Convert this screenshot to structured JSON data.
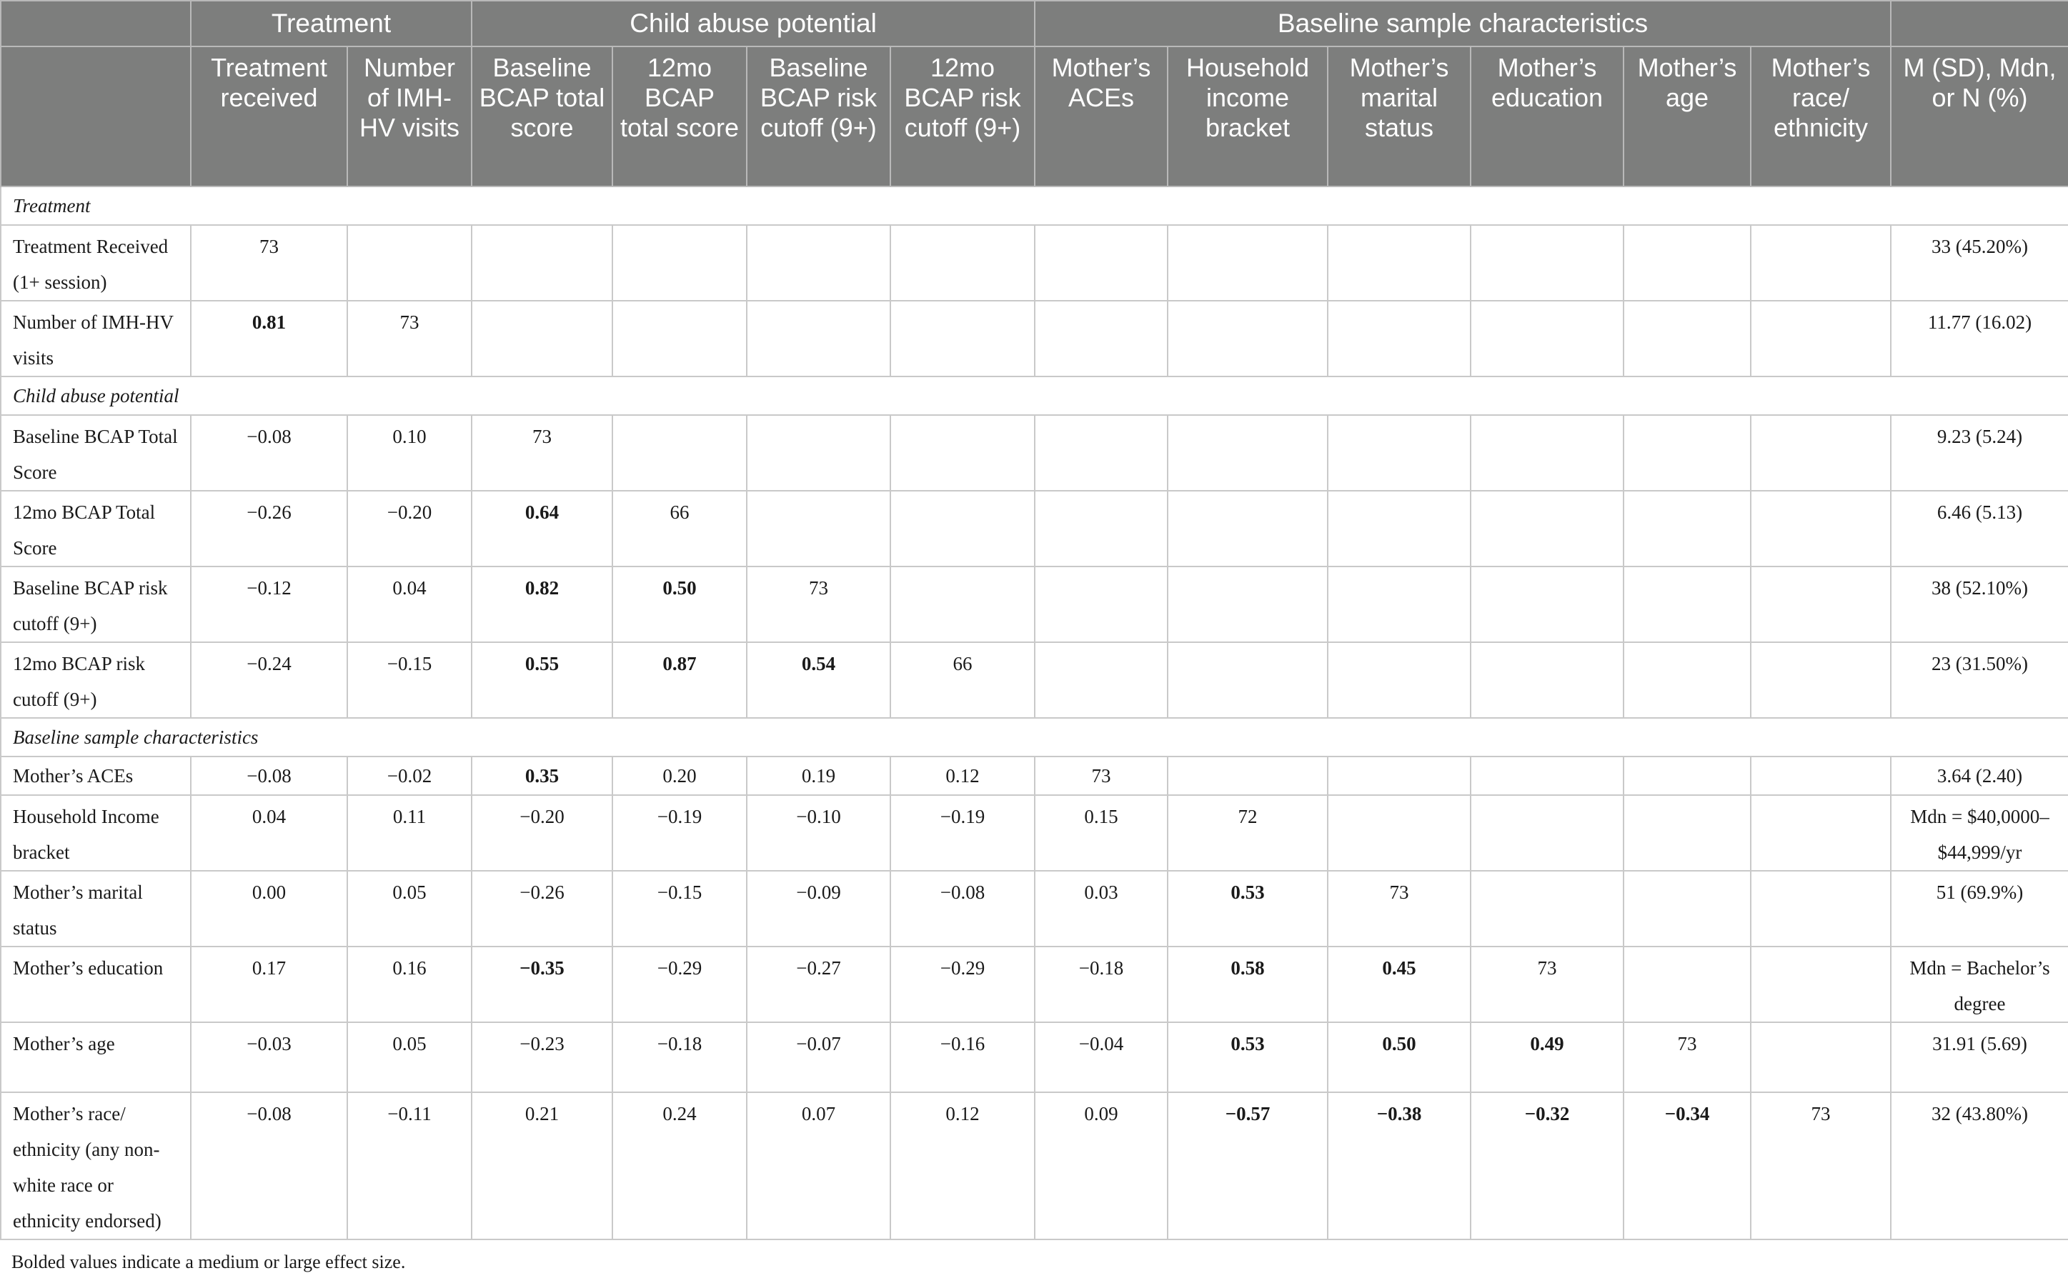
{
  "header": {
    "groups": [
      "Treatment",
      "Child abuse potential",
      "Baseline sample characteristics"
    ],
    "columns": [
      "Treatment received",
      "Number of IMH-HV visits",
      "Baseline BCAP total score",
      "12mo BCAP total score",
      "Baseline BCAP risk cutoff (9+)",
      "12mo BCAP risk cutoff (9+)",
      "Mother’s ACEs",
      "Household income bracket",
      "Mother’s marital status",
      "Mother’s education",
      "Mother’s age",
      "Mother’s race/ ethnicity",
      "M (SD), Mdn, or N (%)"
    ]
  },
  "sections": [
    {
      "title": "Treatment",
      "rows": [
        {
          "label": "Treatment Received (1+ session)",
          "cells": [
            "73",
            "",
            "",
            "",
            "",
            "",
            "",
            "",
            "",
            "",
            "",
            ""
          ],
          "bold": [],
          "summary": "33 (45.20%)"
        },
        {
          "label": "Number of IMH-HV visits",
          "cells": [
            "0.81",
            "73",
            "",
            "",
            "",
            "",
            "",
            "",
            "",
            "",
            "",
            ""
          ],
          "bold": [
            0
          ],
          "summary": "11.77 (16.02)"
        }
      ]
    },
    {
      "title": "Child abuse potential",
      "rows": [
        {
          "label": "Baseline BCAP Total Score",
          "cells": [
            "−0.08",
            "0.10",
            "73",
            "",
            "",
            "",
            "",
            "",
            "",
            "",
            "",
            ""
          ],
          "bold": [],
          "summary": "9.23 (5.24)"
        },
        {
          "label": "12mo BCAP Total Score",
          "cells": [
            "−0.26",
            "−0.20",
            "0.64",
            "66",
            "",
            "",
            "",
            "",
            "",
            "",
            "",
            ""
          ],
          "bold": [
            2
          ],
          "summary": "6.46 (5.13)"
        },
        {
          "label": "Baseline BCAP risk cutoff (9+)",
          "cells": [
            "−0.12",
            "0.04",
            "0.82",
            "0.50",
            "73",
            "",
            "",
            "",
            "",
            "",
            "",
            ""
          ],
          "bold": [
            2,
            3
          ],
          "summary": "38 (52.10%)"
        },
        {
          "label": "12mo BCAP risk cutoff (9+)",
          "cells": [
            "−0.24",
            "−0.15",
            "0.55",
            "0.87",
            "0.54",
            "66",
            "",
            "",
            "",
            "",
            "",
            ""
          ],
          "bold": [
            2,
            3,
            4
          ],
          "summary": "23 (31.50%)"
        }
      ]
    },
    {
      "title": "Baseline sample characteristics",
      "rows": [
        {
          "label": "Mother’s ACEs",
          "cells": [
            "−0.08",
            "−0.02",
            "0.35",
            "0.20",
            "0.19",
            "0.12",
            "73",
            "",
            "",
            "",
            "",
            ""
          ],
          "bold": [
            2
          ],
          "summary": "3.64 (2.40)"
        },
        {
          "label": "Household Income bracket",
          "cells": [
            "0.04",
            "0.11",
            "−0.20",
            "−0.19",
            "−0.10",
            "−0.19",
            "0.15",
            "72",
            "",
            "",
            "",
            ""
          ],
          "bold": [],
          "summary": "Mdn = $40,0000–$44,999/yr"
        },
        {
          "label": "Mother’s marital status",
          "cells": [
            "0.00",
            "0.05",
            "−0.26",
            "−0.15",
            "−0.09",
            "−0.08",
            "0.03",
            "0.53",
            "73",
            "",
            "",
            ""
          ],
          "bold": [
            7
          ],
          "summary": "51 (69.9%)"
        },
        {
          "label": "Mother’s education",
          "cells": [
            "0.17",
            "0.16",
            "−0.35",
            "−0.29",
            "−0.27",
            "−0.29",
            "−0.18",
            "0.58",
            "0.45",
            "73",
            "",
            ""
          ],
          "bold": [
            2,
            7,
            8
          ],
          "summary": "Mdn = Bachelor’s degree"
        },
        {
          "label": "Mother’s age",
          "cells": [
            "−0.03",
            "0.05",
            "−0.23",
            "−0.18",
            "−0.07",
            "−0.16",
            "−0.04",
            "0.53",
            "0.50",
            "0.49",
            "73",
            ""
          ],
          "bold": [
            7,
            8,
            9
          ],
          "summary": "31.91 (5.69)"
        },
        {
          "label": "Mother’s race/ ethnicity (any non-white race or ethnicity endorsed)",
          "cells": [
            "−0.08",
            "−0.11",
            "0.21",
            "0.24",
            "0.07",
            "0.12",
            "0.09",
            "−0.57",
            "−0.38",
            "−0.32",
            "−0.34",
            "73"
          ],
          "bold": [
            7,
            8,
            9,
            10
          ],
          "summary": "32 (43.80%)"
        }
      ]
    }
  ],
  "footnote": "Bolded values indicate a medium or large effect size."
}
